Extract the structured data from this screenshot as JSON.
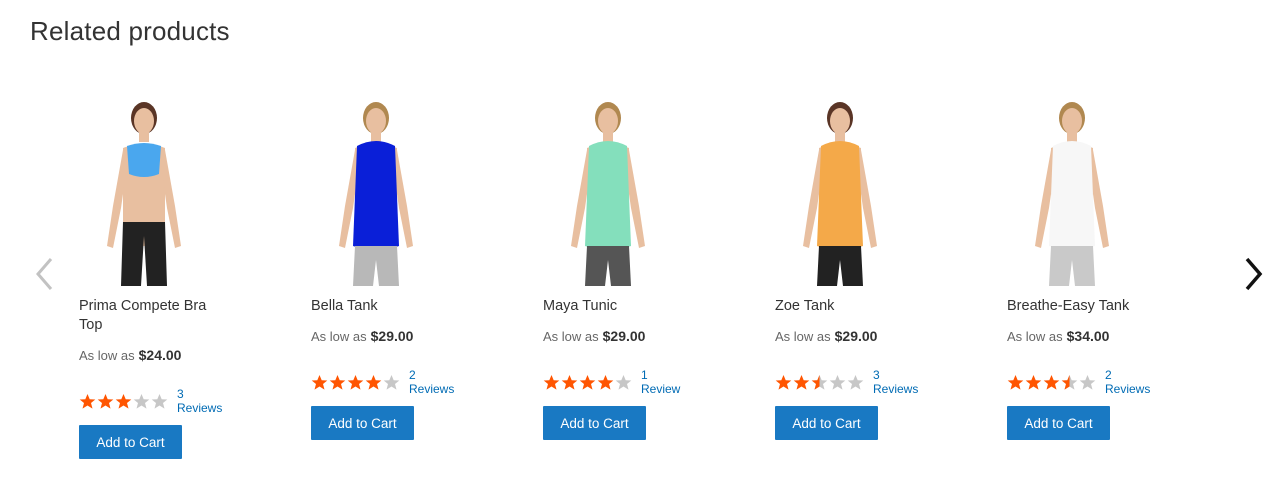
{
  "section": {
    "title": "Related products"
  },
  "navigation": {
    "prev_icon": "chevron-left-icon",
    "next_icon": "chevron-right-icon"
  },
  "price_prefix": "As low as",
  "add_to_cart_label": "Add to Cart",
  "colors": {
    "button": "#1979c3",
    "star_filled": "#ff5501",
    "star_empty": "#c7c7c7",
    "link": "#006bb4"
  },
  "products": [
    {
      "name": "Prima Compete Bra Top",
      "price": "$24.00",
      "rating_stars": 3,
      "reviews": "3 Reviews",
      "garment_color": "#4aa7ee",
      "bottom_color": "#222222"
    },
    {
      "name": "Bella Tank",
      "price": "$29.00",
      "rating_stars": 4,
      "reviews": "2 Reviews",
      "garment_color": "#0a1fd8",
      "bottom_color": "#b8b8b8"
    },
    {
      "name": "Maya Tunic",
      "price": "$29.00",
      "rating_stars": 4,
      "reviews": "1 Review",
      "garment_color": "#84dfbc",
      "bottom_color": "#555555"
    },
    {
      "name": "Zoe Tank",
      "price": "$29.00",
      "rating_stars": 2.5,
      "reviews": "3 Reviews",
      "garment_color": "#f4a949",
      "bottom_color": "#222222"
    },
    {
      "name": "Breathe-Easy Tank",
      "price": "$34.00",
      "rating_stars": 3.5,
      "reviews": "2 Reviews",
      "garment_color": "#f7f7f7",
      "bottom_color": "#c9c9c9"
    }
  ]
}
